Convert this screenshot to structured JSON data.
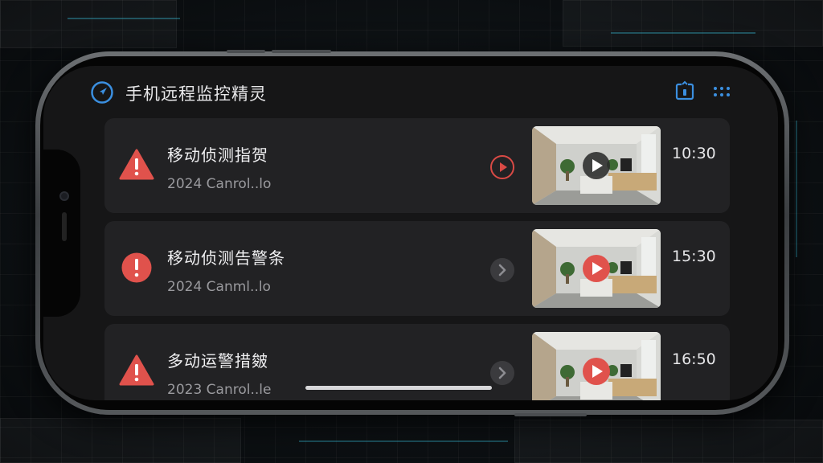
{
  "app": {
    "title": "手机远程监控精灵"
  },
  "header": {
    "icons": [
      "navigation-icon",
      "screen-capture-icon",
      "grid-menu-icon"
    ],
    "accent_color": "#3b8fe0"
  },
  "events": [
    {
      "title": "移动侦测指贺",
      "date": "2024 Canrol..lo",
      "time": "10:30",
      "alert_shape": "triangle",
      "play_button_style": "red-outline",
      "thumbnail_play_style": "dark"
    },
    {
      "title": "移动侦测告警条",
      "date": "2024 Canml..lo",
      "time": "15:30",
      "alert_shape": "circle",
      "play_button_style": "gray-chevron",
      "thumbnail_play_style": "red"
    },
    {
      "title": "多动运警措皴",
      "date": "2023 Canrol..le",
      "time": "16:50",
      "alert_shape": "triangle",
      "play_button_style": "gray-chevron",
      "thumbnail_play_style": "red"
    }
  ],
  "colors": {
    "alert_red": "#e0524c",
    "card_background": "#222224",
    "screen_background": "#161617"
  }
}
